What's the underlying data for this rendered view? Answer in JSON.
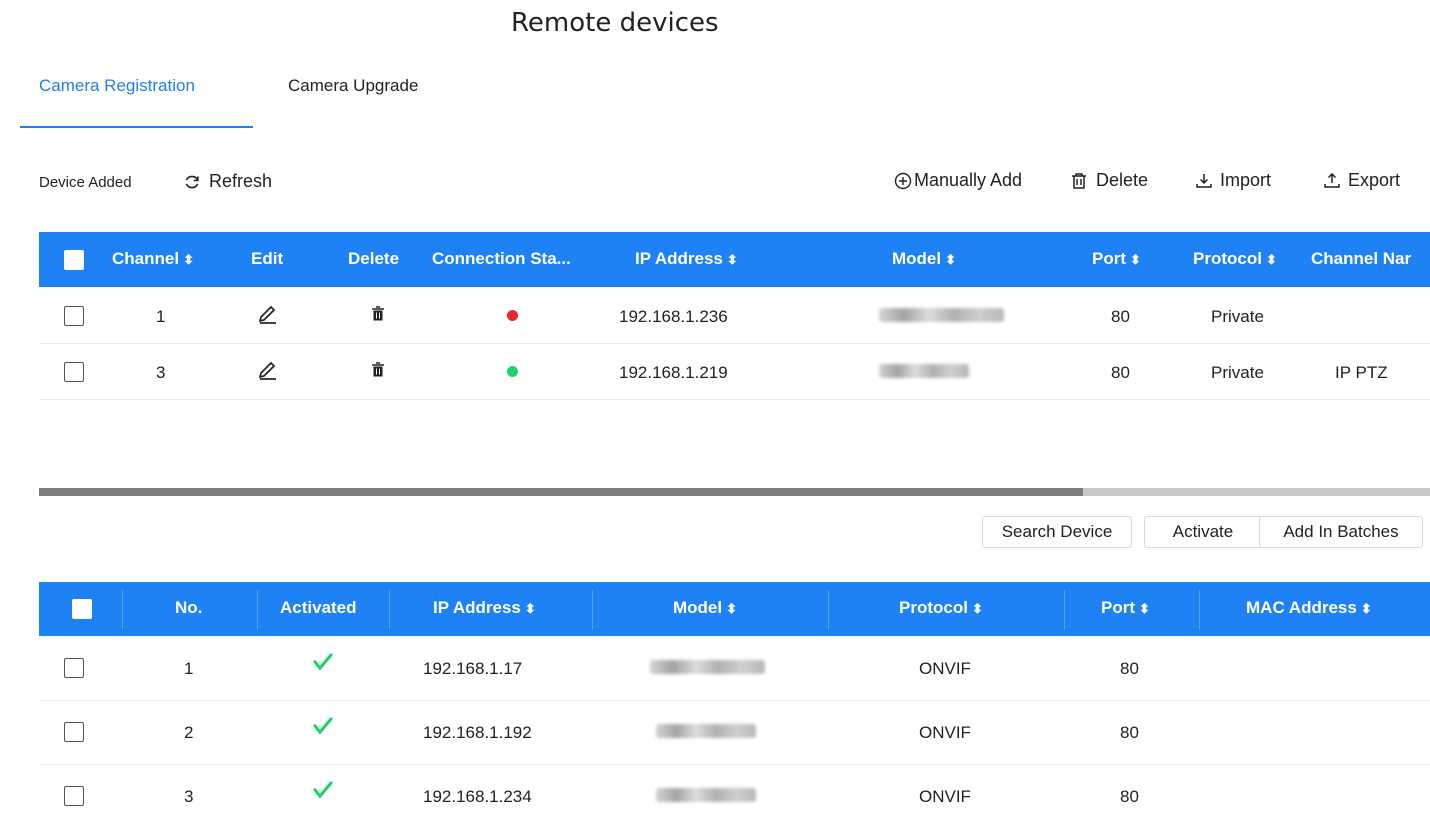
{
  "page": {
    "title": "Remote devices"
  },
  "tabs": [
    {
      "label": "Camera Registration",
      "active": true
    },
    {
      "label": "Camera Upgrade",
      "active": false
    }
  ],
  "toolbar": {
    "label": "Device Added",
    "refresh": "Refresh",
    "manually_add": "Manually Add",
    "delete": "Delete",
    "import": "Import",
    "export": "Export"
  },
  "added_table": {
    "headers": {
      "channel": "Channel",
      "edit": "Edit",
      "delete": "Delete",
      "connection_status": "Connection Sta...",
      "ip_address": "IP Address",
      "model": "Model",
      "port": "Port",
      "protocol": "Protocol",
      "channel_name": "Channel Nar"
    },
    "rows": [
      {
        "channel": "1",
        "status": "offline",
        "status_color": "#f0262e",
        "ip": "192.168.1.236",
        "port": "80",
        "protocol": "Private",
        "channel_name": ""
      },
      {
        "channel": "3",
        "status": "online",
        "status_color": "#1fd16a",
        "ip": "192.168.1.219",
        "port": "80",
        "protocol": "Private",
        "channel_name": "IP PTZ"
      }
    ]
  },
  "search_actions": {
    "search_device": "Search Device",
    "activate": "Activate",
    "add_in_batches": "Add In Batches"
  },
  "search_table": {
    "headers": {
      "no": "No.",
      "activated": "Activated",
      "ip_address": "IP Address",
      "model": "Model",
      "protocol": "Protocol",
      "port": "Port",
      "mac_address": "MAC Address"
    },
    "rows": [
      {
        "no": "1",
        "activated": true,
        "ip": "192.168.1.17",
        "protocol": "ONVIF",
        "port": "80"
      },
      {
        "no": "2",
        "activated": true,
        "ip": "192.168.1.192",
        "protocol": "ONVIF",
        "port": "80"
      },
      {
        "no": "3",
        "activated": true,
        "ip": "192.168.1.234",
        "protocol": "ONVIF",
        "port": "80"
      }
    ]
  },
  "colors": {
    "accent": "#1f7ff0",
    "header_bg": "#1e82f5",
    "check": "#1fd16a"
  }
}
